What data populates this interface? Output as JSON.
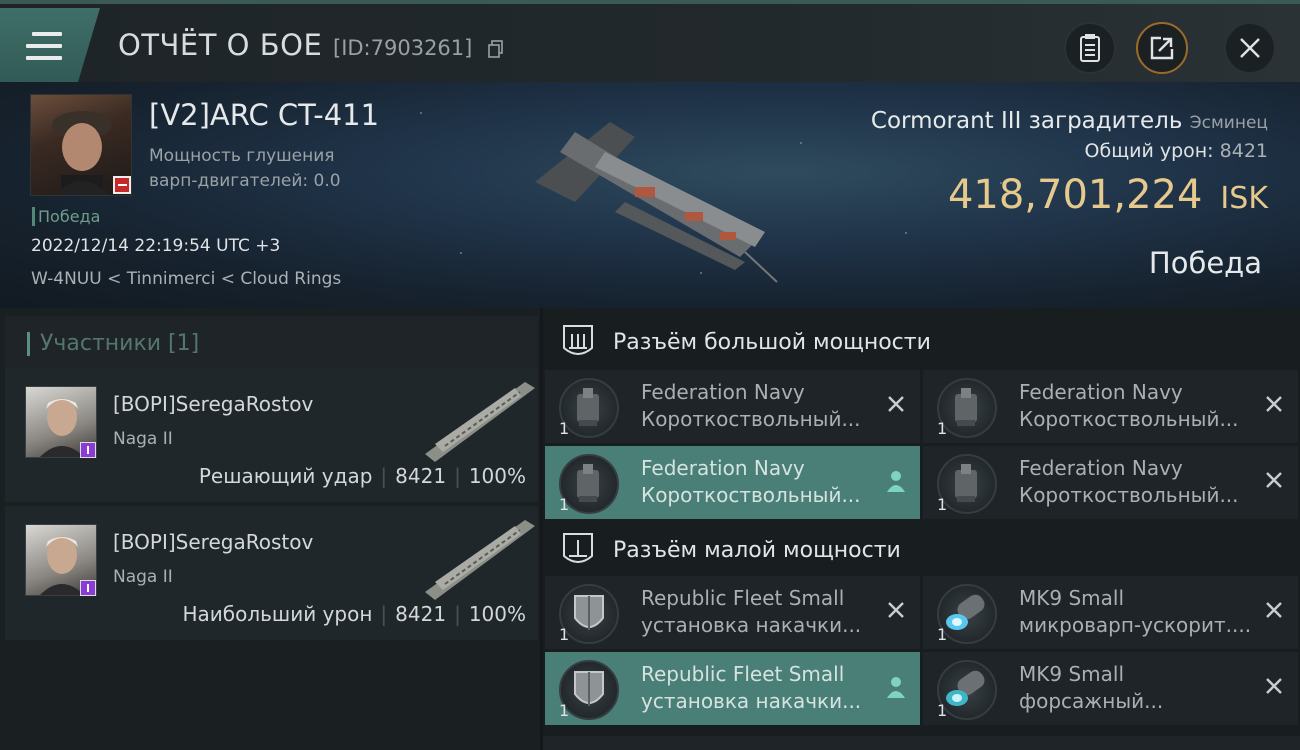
{
  "header": {
    "title": "ОТЧЁТ О БОЕ",
    "report_id": "[ID:7903261]",
    "icons": [
      "menu-icon",
      "copy-icon",
      "clipboard-icon",
      "share-icon",
      "close-icon"
    ],
    "accent_color": "#3f6e68"
  },
  "victim": {
    "pilot_name": "[V2]ARC CT-411",
    "warp_scramble_label": "Мощность глушения варп-двигателей: 0.0",
    "result_tag": "Победа",
    "datetime": "2022/12/14 22:19:54 UTC +3",
    "location": "W-4NUU < Tinnimerci < Cloud Rings",
    "ship_name": "Cormorant III заградитель",
    "ship_class": "Эсминец",
    "total_damage_label": "Общий урон:",
    "total_damage_value": "8421",
    "isk_value": "418,701,224",
    "isk_unit": "ISK",
    "result": "Победа"
  },
  "participants": {
    "title": "Участники [1]",
    "items": [
      {
        "name": "[BOPI]SeregaRostov",
        "ship": "Naga II",
        "role": "Решающий удар",
        "damage": "8421",
        "percent": "100%"
      },
      {
        "name": "[BOPI]SeregaRostov",
        "ship": "Naga II",
        "role": "Наибольший урон",
        "damage": "8421",
        "percent": "100%"
      }
    ]
  },
  "slots": {
    "high": {
      "title": "Разъём большой мощности",
      "modules": [
        {
          "line1": "Federation Navy",
          "line2": "Короткоствольный...",
          "qty": "1",
          "state": "destroyed"
        },
        {
          "line1": "Federation Navy",
          "line2": "Короткоствольный...",
          "qty": "1",
          "state": "destroyed"
        },
        {
          "line1": "Federation Navy",
          "line2": "Короткоствольный...",
          "qty": "1",
          "state": "dropped"
        },
        {
          "line1": "Federation Navy",
          "line2": "Короткоствольный...",
          "qty": "1",
          "state": "destroyed"
        }
      ]
    },
    "low": {
      "title": "Разъём малой мощности",
      "modules": [
        {
          "line1": "Republic Fleet Small",
          "line2": "установка накачки...",
          "qty": "1",
          "state": "destroyed"
        },
        {
          "line1": "MK9 Small",
          "line2": "микроварп-ускорит....",
          "qty": "1",
          "state": "destroyed"
        },
        {
          "line1": "Republic Fleet Small",
          "line2": "установка накачки...",
          "qty": "1",
          "state": "dropped"
        },
        {
          "line1": "MK9 Small",
          "line2": "форсажный...",
          "qty": "1",
          "state": "destroyed"
        }
      ]
    }
  }
}
